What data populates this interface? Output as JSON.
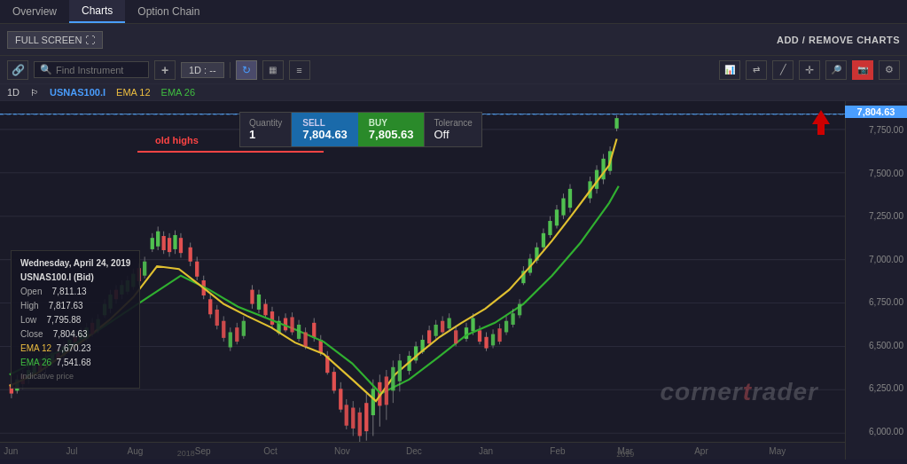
{
  "tabs": [
    {
      "id": "overview",
      "label": "Overview",
      "active": false
    },
    {
      "id": "charts",
      "label": "Charts",
      "active": true
    },
    {
      "id": "option-chain",
      "label": "Option Chain",
      "active": false
    }
  ],
  "toolbar": {
    "fullscreen_label": "FULL SCREEN",
    "add_remove_label": "ADD / REMOVE CHARTS",
    "search_placeholder": "Find Instrument",
    "timeframe": "1D : --",
    "plus_label": "+",
    "refresh_tooltip": "Refresh"
  },
  "chart_labels": {
    "timeframe": "1D",
    "instrument": "USNAS100.I",
    "ema12_label": "EMA 12",
    "ema26_label": "EMA 26"
  },
  "trade_widget": {
    "quantity_label": "Quantity",
    "quantity_value": "1",
    "sell_label": "SELL",
    "sell_price": "7,804.63",
    "buy_label": "BUY",
    "buy_price": "7,805.63",
    "tolerance_label": "Tolerance",
    "tolerance_value": "Off"
  },
  "current_price": "7,804.63",
  "annotations": {
    "old_highs": "old highs"
  },
  "info_box": {
    "date": "Wednesday, April 24, 2019",
    "instrument": "USNAS100.I (Bid)",
    "open_label": "Open",
    "open_value": "7,811.13",
    "high_label": "High",
    "high_value": "7,817.63",
    "low_label": "Low",
    "low_value": "7,795.88",
    "close_label": "Close",
    "close_value": "7,804.63",
    "ema12_label": "EMA 12",
    "ema12_value": "7,670.23",
    "ema26_label": "EMA 26",
    "ema26_value": "7,541.68",
    "indicative_label": "Indicative price"
  },
  "price_levels": [
    {
      "price": "7,750.00",
      "pct": 8
    },
    {
      "price": "7,500.00",
      "pct": 20
    },
    {
      "price": "7,250.00",
      "pct": 32
    },
    {
      "price": "7,000.00",
      "pct": 44
    },
    {
      "price": "6,750.00",
      "pct": 56
    },
    {
      "price": "6,500.00",
      "pct": 68
    },
    {
      "price": "6,250.00",
      "pct": 80
    },
    {
      "price": "6,000.00",
      "pct": 92
    }
  ],
  "x_labels": [
    {
      "label": "Jun",
      "pct": 1
    },
    {
      "label": "Jul",
      "pct": 5
    },
    {
      "label": "Aug",
      "pct": 13
    },
    {
      "label": "Sep",
      "pct": 22
    },
    {
      "label": "Oct",
      "pct": 31
    },
    {
      "label": "Nov",
      "pct": 40
    },
    {
      "label": "Dec",
      "pct": 49
    },
    {
      "label": "Jan",
      "pct": 57
    },
    {
      "label": "Feb",
      "pct": 65
    },
    {
      "label": "Mar",
      "pct": 73
    },
    {
      "label": "2019",
      "pct": 73
    },
    {
      "label": "Apr",
      "pct": 82
    },
    {
      "label": "May",
      "pct": 91
    }
  ],
  "watermark": "cornertrader",
  "icons": {
    "search": "🔍",
    "expand": "⛶",
    "settings": "⚙",
    "camera": "📷",
    "zoom": "🔎",
    "crosshair": "+",
    "line": "╱",
    "drawing": "✏",
    "indicators": "📊",
    "compare": "⇄",
    "fullscreen_icon": "⛶"
  }
}
